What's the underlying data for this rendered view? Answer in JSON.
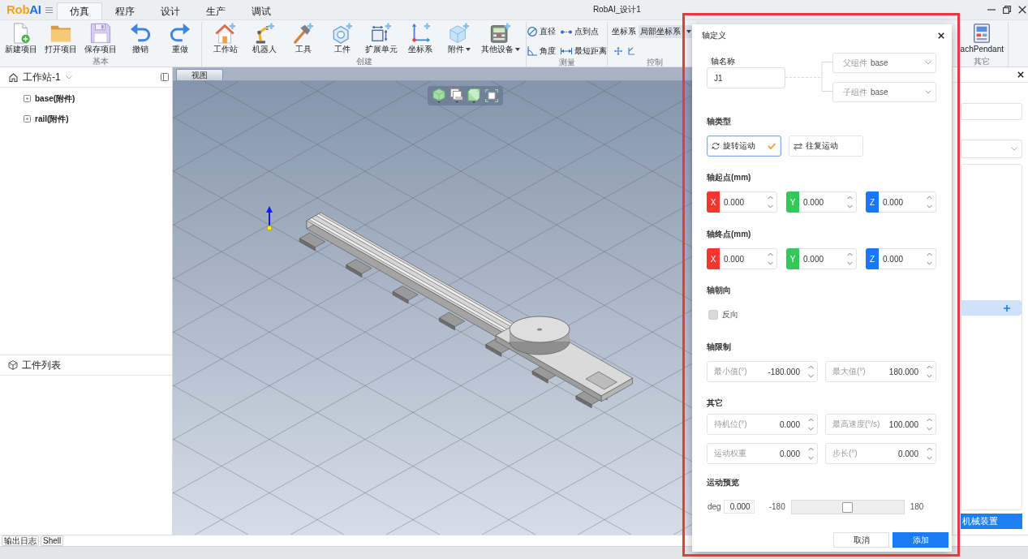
{
  "window": {
    "title": "RobAI_设计1"
  },
  "logo": [
    "Rob",
    "AI"
  ],
  "menu_tabs": [
    {
      "label": "仿真",
      "selected": true
    },
    {
      "label": "程序",
      "selected": false
    },
    {
      "label": "设计",
      "selected": false
    },
    {
      "label": "生产",
      "selected": false
    },
    {
      "label": "调试",
      "selected": false
    }
  ],
  "ribbon": [
    {
      "name": "基本",
      "kind": "large",
      "items": [
        {
          "kind": "new",
          "label": "新建项目",
          "dropdown": false
        },
        {
          "kind": "open",
          "label": "打开项目",
          "dropdown": false
        },
        {
          "kind": "save",
          "label": "保存项目",
          "dropdown": false
        },
        {
          "kind": "undo",
          "label": "撤销",
          "dropdown": false
        },
        {
          "kind": "redo",
          "label": "重做",
          "dropdown": false
        }
      ]
    },
    {
      "name": "创建",
      "kind": "large",
      "items": [
        {
          "kind": "station",
          "label": "工作站",
          "dropdown": false
        },
        {
          "kind": "robot",
          "label": "机器人",
          "dropdown": false
        },
        {
          "kind": "tool",
          "label": "工具",
          "dropdown": false
        },
        {
          "kind": "workpiece",
          "label": "工件",
          "dropdown": false
        },
        {
          "kind": "extension",
          "label": "扩展单元",
          "dropdown": false
        },
        {
          "kind": "frame",
          "label": "坐标系",
          "dropdown": false
        },
        {
          "kind": "attachment",
          "label": "附件",
          "dropdown": true
        },
        {
          "kind": "device",
          "label": "其他设备",
          "dropdown": true
        }
      ]
    },
    {
      "name": "测量",
      "kind": "compact",
      "items": [
        {
          "kind": "diameter",
          "label": "直径"
        },
        {
          "kind": "point",
          "label": "点到点"
        },
        {
          "kind": "angle",
          "label": "角度"
        },
        {
          "kind": "distance",
          "label": "最短距离"
        }
      ]
    },
    {
      "name": "控制",
      "kind": "frame",
      "label": "坐标系",
      "value": "局部坐标系"
    },
    {
      "name": "其它",
      "kind": "large",
      "items": [
        {
          "kind": "pendant",
          "label": "achPendant",
          "dropdown": false
        }
      ]
    }
  ],
  "tree": {
    "title": "工作站-1",
    "items": [
      {
        "label": "base(附件)"
      },
      {
        "label": "rail(附件)"
      }
    ]
  },
  "workpieces": {
    "title": "工件列表"
  },
  "viewport": {
    "tab": "视图"
  },
  "properties_panel": {
    "button": "机械装置"
  },
  "bottom_tabs": [
    "输出日志",
    "Shell"
  ],
  "dialog": {
    "title": "轴定义",
    "name_field": {
      "label": "轴名称",
      "value": "J1"
    },
    "parent_select": {
      "label": "父组件",
      "value": "base"
    },
    "child_select": {
      "label": "子组件",
      "value": "base"
    },
    "axis_type": {
      "label": "轴类型",
      "options": [
        {
          "kind": "rotary",
          "label": "旋转运动",
          "selected": true
        },
        {
          "kind": "linear",
          "label": "往复运动",
          "selected": false
        }
      ]
    },
    "start_point": {
      "label": "轴起点(mm)",
      "coords": [
        {
          "axis": "X",
          "value": "0.000",
          "color": "#f5352e"
        },
        {
          "axis": "Y",
          "value": "0.000",
          "color": "#34c759"
        },
        {
          "axis": "Z",
          "value": "0.000",
          "color": "#1677ff"
        }
      ]
    },
    "end_point": {
      "label": "轴终点(mm)",
      "coords": [
        {
          "axis": "X",
          "value": "0.000",
          "color": "#f5352e"
        },
        {
          "axis": "Y",
          "value": "0.000",
          "color": "#34c759"
        },
        {
          "axis": "Z",
          "value": "0.000",
          "color": "#1677ff"
        }
      ]
    },
    "direction": {
      "label": "轴朝向",
      "reverse": {
        "label": "反向",
        "checked": false
      }
    },
    "limits": {
      "label": "轴限制",
      "fields": [
        {
          "label": "最小值(°)",
          "value": "-180.000"
        },
        {
          "label": "最大值(°)",
          "value": "180.000"
        }
      ]
    },
    "other": {
      "label": "其它",
      "fields": [
        {
          "label": "待机位(°)",
          "value": "0.000"
        },
        {
          "label": "最高速度(°/s)",
          "value": "100.000"
        },
        {
          "label": "运动权重",
          "value": "0.000"
        },
        {
          "label": "步长(°)",
          "value": "0.000"
        }
      ]
    },
    "preview": {
      "label": "运动预览",
      "unit": "deg",
      "value": "0.000",
      "min": "-180",
      "max": "180",
      "level": 0.5
    },
    "buttons": [
      {
        "kind": "secondary",
        "label": "取消"
      },
      {
        "kind": "primary",
        "label": "添加"
      }
    ]
  }
}
